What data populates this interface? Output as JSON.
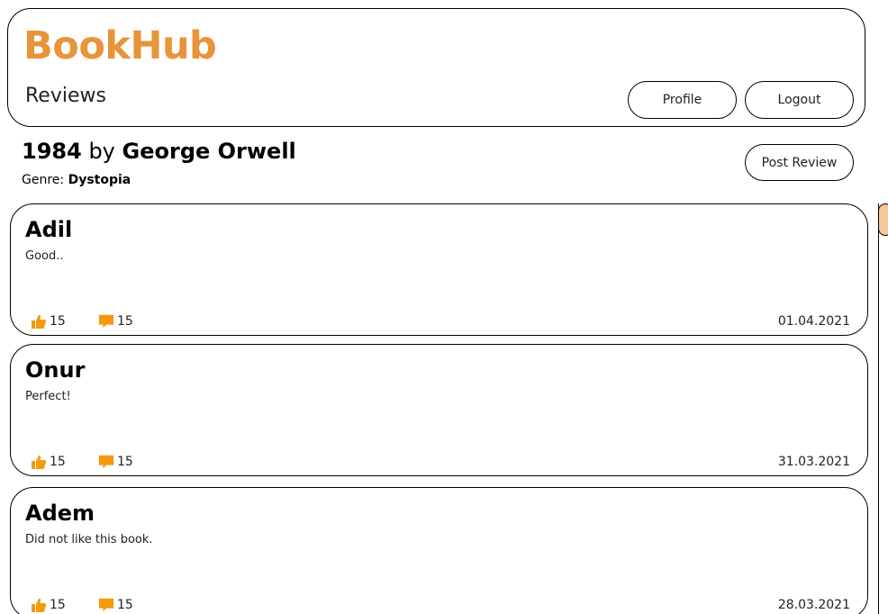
{
  "app": {
    "brand": "BookHub",
    "page_title": "Reviews",
    "accent": "#e8943a"
  },
  "nav": {
    "profile_label": "Profile",
    "logout_label": "Logout"
  },
  "book": {
    "title": "1984",
    "by": "by",
    "author": "George Orwell",
    "genre_label": "Genre:",
    "genre": "Dystopia",
    "post_review_label": "Post Review"
  },
  "reviews": [
    {
      "author": "Adil",
      "text": "Good..",
      "likes": "15",
      "comments": "15",
      "date": "01.04.2021"
    },
    {
      "author": "Onur",
      "text": "Perfect!",
      "likes": "15",
      "comments": "15",
      "date": "31.03.2021"
    },
    {
      "author": "Adem",
      "text": "Did not like this book.",
      "likes": "15",
      "comments": "15",
      "date": "28.03.2021"
    }
  ],
  "icons": {
    "like": "thumbs-up-icon",
    "comment": "comment-icon",
    "icon_color": "#f59a0c"
  }
}
